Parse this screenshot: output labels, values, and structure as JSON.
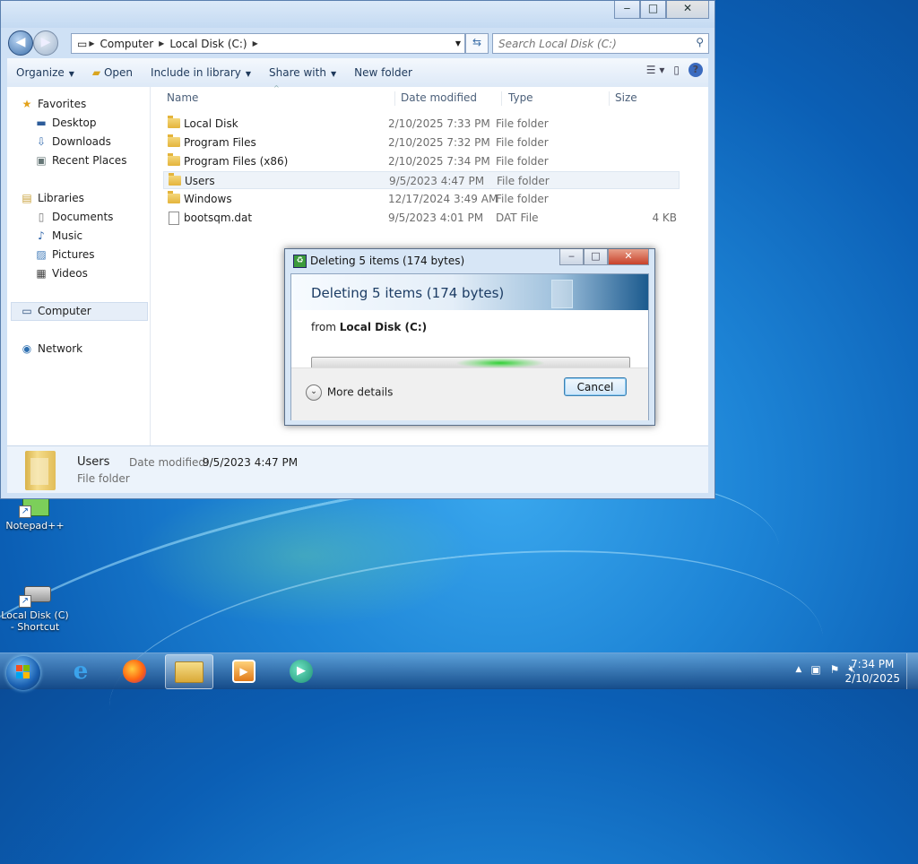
{
  "explorer": {
    "window_buttons": {
      "minimize": "‒",
      "maximize": "□",
      "close": "✕"
    },
    "address": {
      "crumbs": [
        "Computer",
        "Local Disk (C:)"
      ]
    },
    "search": {
      "placeholder": "Search Local Disk (C:)"
    },
    "toolbar": {
      "organize": "Organize",
      "open": "Open",
      "include_in_library": "Include in library",
      "share_with": "Share with",
      "new_folder": "New folder"
    },
    "nav": {
      "favorites": "Favorites",
      "desktop": "Desktop",
      "downloads": "Downloads",
      "recent_places": "Recent Places",
      "libraries": "Libraries",
      "documents": "Documents",
      "music": "Music",
      "pictures": "Pictures",
      "videos": "Videos",
      "computer": "Computer",
      "network": "Network"
    },
    "columns": {
      "name": "Name",
      "date_modified": "Date modified",
      "type": "Type",
      "size": "Size"
    },
    "files": [
      {
        "name": "Local Disk",
        "date": "2/10/2025 7:33 PM",
        "type": "File folder",
        "size": ""
      },
      {
        "name": "Program Files",
        "date": "2/10/2025 7:32 PM",
        "type": "File folder",
        "size": ""
      },
      {
        "name": "Program Files (x86)",
        "date": "2/10/2025 7:34 PM",
        "type": "File folder",
        "size": ""
      },
      {
        "name": "Users",
        "date": "9/5/2023 4:47 PM",
        "type": "File folder",
        "size": ""
      },
      {
        "name": "Windows",
        "date": "12/17/2024 3:49 AM",
        "type": "File folder",
        "size": ""
      },
      {
        "name": "bootsqm.dat",
        "date": "9/5/2023 4:01 PM",
        "type": "DAT File",
        "size": "4 KB"
      }
    ],
    "details": {
      "name": "Users",
      "date_label": "Date modified:",
      "date_value": "9/5/2023 4:47 PM",
      "type": "File folder"
    }
  },
  "dialog": {
    "title": "Deleting 5 items (174 bytes)",
    "heading": "Deleting 5 items (174 bytes)",
    "from_prefix": "from",
    "from_location": "Local Disk (C:)",
    "more_details": "More details",
    "cancel": "Cancel"
  },
  "desktop": {
    "icons": [
      {
        "label": "Notepad++"
      },
      {
        "label_line1": "Local Disk (C)",
        "label_line2": "- Shortcut"
      }
    ]
  },
  "taskbar": {
    "clock_time": "7:34 PM",
    "clock_date": "2/10/2025"
  }
}
